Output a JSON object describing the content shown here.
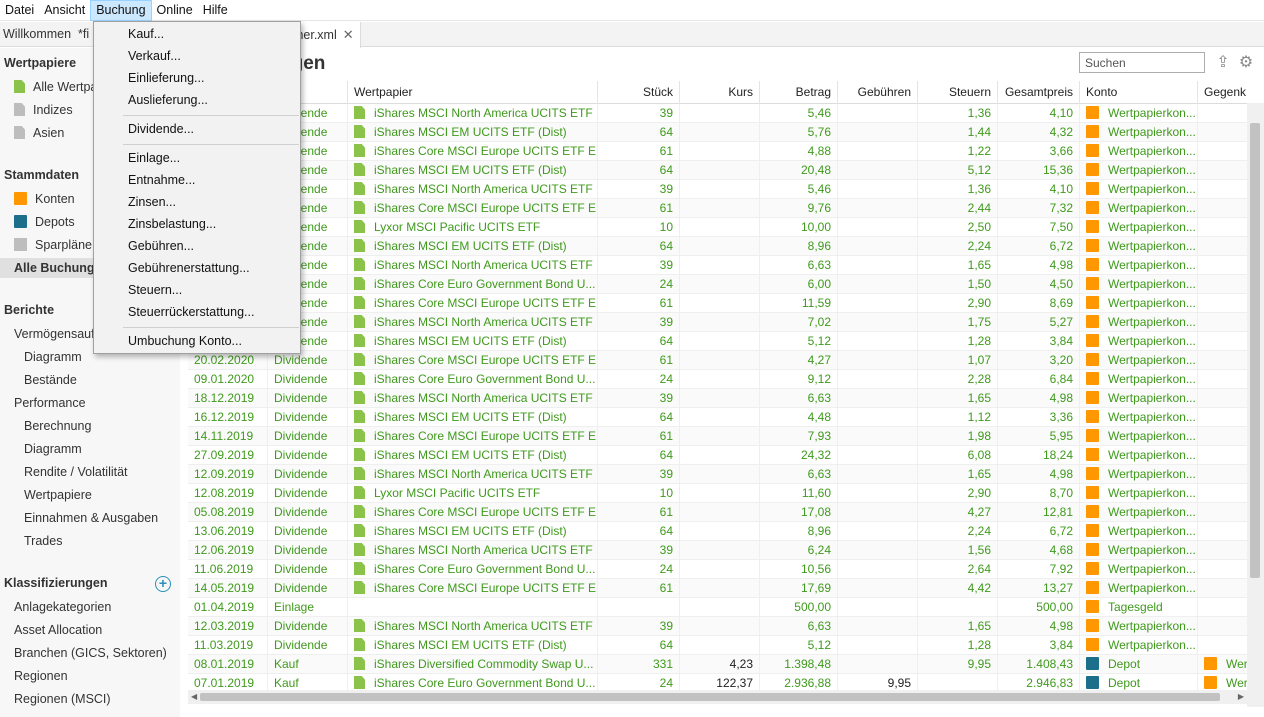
{
  "menubar": [
    "Datei",
    "Ansicht",
    "Buchung",
    "Online",
    "Hilfe"
  ],
  "tabs": {
    "welcome": "Willkommen",
    "modified_prefix": "*fi",
    "file_suffix": "mer.xml"
  },
  "sidebar": {
    "wertpapiere_head": "Wertpapiere",
    "wertpapiere": [
      "Alle Wertpa",
      "Indizes",
      "Asien"
    ],
    "stammdaten_head": "Stammdaten",
    "stammdaten": [
      "Konten",
      "Depots",
      "Sparpläne",
      "Alle Buchunge"
    ],
    "berichte_head": "Berichte",
    "berichte": [
      "Vermögensaufs",
      "Diagramm",
      "Bestände",
      "Performance",
      "Berechnung",
      "Diagramm",
      "Rendite / Volatilität",
      "Wertpapiere",
      "Einnahmen & Ausgaben",
      "Trades"
    ],
    "klass_head": "Klassifizierungen",
    "klass": [
      "Anlagekategorien",
      "Asset Allocation",
      "Branchen (GICS, Sektoren)",
      "Regionen",
      "Regionen (MSCI)"
    ]
  },
  "main": {
    "title": "ngen",
    "search_placeholder": "Suchen",
    "columns": [
      "Wertpapier",
      "Stück",
      "Kurs",
      "Betrag",
      "Gebühren",
      "Steuern",
      "Gesamtpreis",
      "Konto",
      "Gegenk"
    ]
  },
  "rows": [
    {
      "date": "",
      "type": "Dividende",
      "sec": "iShares MSCI North America UCITS ETF",
      "qty": "39",
      "price": "",
      "amount": "5,46",
      "fees": "",
      "taxes": "1,36",
      "total": "4,10",
      "acct": "Wertpapierkon...",
      "acct_icon": "orange",
      "counter": ""
    },
    {
      "date": "",
      "type": "Dividende",
      "sec": "iShares MSCI EM UCITS ETF (Dist)",
      "qty": "64",
      "price": "",
      "amount": "5,76",
      "fees": "",
      "taxes": "1,44",
      "total": "4,32",
      "acct": "Wertpapierkon...",
      "acct_icon": "orange",
      "counter": ""
    },
    {
      "date": "",
      "type": "Dividende",
      "sec": "iShares Core MSCI Europe UCITS ETF EU...",
      "qty": "61",
      "price": "",
      "amount": "4,88",
      "fees": "",
      "taxes": "1,22",
      "total": "3,66",
      "acct": "Wertpapierkon...",
      "acct_icon": "orange",
      "counter": ""
    },
    {
      "date": "",
      "type": "Dividende",
      "sec": "iShares MSCI EM UCITS ETF (Dist)",
      "qty": "64",
      "price": "",
      "amount": "20,48",
      "fees": "",
      "taxes": "5,12",
      "total": "15,36",
      "acct": "Wertpapierkon...",
      "acct_icon": "orange",
      "counter": ""
    },
    {
      "date": "",
      "type": "Dividende",
      "sec": "iShares MSCI North America UCITS ETF",
      "qty": "39",
      "price": "",
      "amount": "5,46",
      "fees": "",
      "taxes": "1,36",
      "total": "4,10",
      "acct": "Wertpapierkon...",
      "acct_icon": "orange",
      "counter": ""
    },
    {
      "date": "",
      "type": "Dividende",
      "sec": "iShares Core MSCI Europe UCITS ETF EU...",
      "qty": "61",
      "price": "",
      "amount": "9,76",
      "fees": "",
      "taxes": "2,44",
      "total": "7,32",
      "acct": "Wertpapierkon...",
      "acct_icon": "orange",
      "counter": ""
    },
    {
      "date": "",
      "type": "Dividende",
      "sec": "Lyxor MSCI Pacific UCITS ETF",
      "qty": "10",
      "price": "",
      "amount": "10,00",
      "fees": "",
      "taxes": "2,50",
      "total": "7,50",
      "acct": "Wertpapierkon...",
      "acct_icon": "orange",
      "counter": ""
    },
    {
      "date": "",
      "type": "Dividende",
      "sec": "iShares MSCI EM UCITS ETF (Dist)",
      "qty": "64",
      "price": "",
      "amount": "8,96",
      "fees": "",
      "taxes": "2,24",
      "total": "6,72",
      "acct": "Wertpapierkon...",
      "acct_icon": "orange",
      "counter": ""
    },
    {
      "date": "",
      "type": "Dividende",
      "sec": "iShares MSCI North America UCITS ETF",
      "qty": "39",
      "price": "",
      "amount": "6,63",
      "fees": "",
      "taxes": "1,65",
      "total": "4,98",
      "acct": "Wertpapierkon...",
      "acct_icon": "orange",
      "counter": ""
    },
    {
      "date": "",
      "type": "Dividende",
      "sec": "iShares Core Euro Government Bond U...",
      "qty": "24",
      "price": "",
      "amount": "6,00",
      "fees": "",
      "taxes": "1,50",
      "total": "4,50",
      "acct": "Wertpapierkon...",
      "acct_icon": "orange",
      "counter": ""
    },
    {
      "date": "",
      "type": "Dividende",
      "sec": "iShares Core MSCI Europe UCITS ETF EU...",
      "qty": "61",
      "price": "",
      "amount": "11,59",
      "fees": "",
      "taxes": "2,90",
      "total": "8,69",
      "acct": "Wertpapierkon...",
      "acct_icon": "orange",
      "counter": ""
    },
    {
      "date": "",
      "type": "Dividende",
      "sec": "iShares MSCI North America UCITS ETF",
      "qty": "39",
      "price": "",
      "amount": "7,02",
      "fees": "",
      "taxes": "1,75",
      "total": "5,27",
      "acct": "Wertpapierkon...",
      "acct_icon": "orange",
      "counter": ""
    },
    {
      "date": "",
      "type": "Dividende",
      "sec": "iShares MSCI EM UCITS ETF (Dist)",
      "qty": "64",
      "price": "",
      "amount": "5,12",
      "fees": "",
      "taxes": "1,28",
      "total": "3,84",
      "acct": "Wertpapierkon...",
      "acct_icon": "orange",
      "counter": ""
    },
    {
      "date": "20.02.2020",
      "type": "Dividende",
      "sec": "iShares Core MSCI Europe UCITS ETF EU...",
      "qty": "61",
      "price": "",
      "amount": "4,27",
      "fees": "",
      "taxes": "1,07",
      "total": "3,20",
      "acct": "Wertpapierkon...",
      "acct_icon": "orange",
      "counter": ""
    },
    {
      "date": "09.01.2020",
      "type": "Dividende",
      "sec": "iShares Core Euro Government Bond U...",
      "qty": "24",
      "price": "",
      "amount": "9,12",
      "fees": "",
      "taxes": "2,28",
      "total": "6,84",
      "acct": "Wertpapierkon...",
      "acct_icon": "orange",
      "counter": ""
    },
    {
      "date": "18.12.2019",
      "type": "Dividende",
      "sec": "iShares MSCI North America UCITS ETF",
      "qty": "39",
      "price": "",
      "amount": "6,63",
      "fees": "",
      "taxes": "1,65",
      "total": "4,98",
      "acct": "Wertpapierkon...",
      "acct_icon": "orange",
      "counter": ""
    },
    {
      "date": "16.12.2019",
      "type": "Dividende",
      "sec": "iShares MSCI EM UCITS ETF (Dist)",
      "qty": "64",
      "price": "",
      "amount": "4,48",
      "fees": "",
      "taxes": "1,12",
      "total": "3,36",
      "acct": "Wertpapierkon...",
      "acct_icon": "orange",
      "counter": ""
    },
    {
      "date": "14.11.2019",
      "type": "Dividende",
      "sec": "iShares Core MSCI Europe UCITS ETF EU...",
      "qty": "61",
      "price": "",
      "amount": "7,93",
      "fees": "",
      "taxes": "1,98",
      "total": "5,95",
      "acct": "Wertpapierkon...",
      "acct_icon": "orange",
      "counter": ""
    },
    {
      "date": "27.09.2019",
      "type": "Dividende",
      "sec": "iShares MSCI EM UCITS ETF (Dist)",
      "qty": "64",
      "price": "",
      "amount": "24,32",
      "fees": "",
      "taxes": "6,08",
      "total": "18,24",
      "acct": "Wertpapierkon...",
      "acct_icon": "orange",
      "counter": ""
    },
    {
      "date": "12.09.2019",
      "type": "Dividende",
      "sec": "iShares MSCI North America UCITS ETF",
      "qty": "39",
      "price": "",
      "amount": "6,63",
      "fees": "",
      "taxes": "1,65",
      "total": "4,98",
      "acct": "Wertpapierkon...",
      "acct_icon": "orange",
      "counter": ""
    },
    {
      "date": "12.08.2019",
      "type": "Dividende",
      "sec": "Lyxor MSCI Pacific UCITS ETF",
      "qty": "10",
      "price": "",
      "amount": "11,60",
      "fees": "",
      "taxes": "2,90",
      "total": "8,70",
      "acct": "Wertpapierkon...",
      "acct_icon": "orange",
      "counter": ""
    },
    {
      "date": "05.08.2019",
      "type": "Dividende",
      "sec": "iShares Core MSCI Europe UCITS ETF EU...",
      "qty": "61",
      "price": "",
      "amount": "17,08",
      "fees": "",
      "taxes": "4,27",
      "total": "12,81",
      "acct": "Wertpapierkon...",
      "acct_icon": "orange",
      "counter": ""
    },
    {
      "date": "13.06.2019",
      "type": "Dividende",
      "sec": "iShares MSCI EM UCITS ETF (Dist)",
      "qty": "64",
      "price": "",
      "amount": "8,96",
      "fees": "",
      "taxes": "2,24",
      "total": "6,72",
      "acct": "Wertpapierkon...",
      "acct_icon": "orange",
      "counter": ""
    },
    {
      "date": "12.06.2019",
      "type": "Dividende",
      "sec": "iShares MSCI North America UCITS ETF",
      "qty": "39",
      "price": "",
      "amount": "6,24",
      "fees": "",
      "taxes": "1,56",
      "total": "4,68",
      "acct": "Wertpapierkon...",
      "acct_icon": "orange",
      "counter": ""
    },
    {
      "date": "11.06.2019",
      "type": "Dividende",
      "sec": "iShares Core Euro Government Bond U...",
      "qty": "24",
      "price": "",
      "amount": "10,56",
      "fees": "",
      "taxes": "2,64",
      "total": "7,92",
      "acct": "Wertpapierkon...",
      "acct_icon": "orange",
      "counter": ""
    },
    {
      "date": "14.05.2019",
      "type": "Dividende",
      "sec": "iShares Core MSCI Europe UCITS ETF EU...",
      "qty": "61",
      "price": "",
      "amount": "17,69",
      "fees": "",
      "taxes": "4,42",
      "total": "13,27",
      "acct": "Wertpapierkon...",
      "acct_icon": "orange",
      "counter": ""
    },
    {
      "date": "01.04.2019",
      "type": "Einlage",
      "sec": "",
      "qty": "",
      "price": "",
      "amount": "500,00",
      "fees": "",
      "taxes": "",
      "total": "500,00",
      "acct": "Tagesgeld",
      "acct_icon": "orange",
      "counter": ""
    },
    {
      "date": "12.03.2019",
      "type": "Dividende",
      "sec": "iShares MSCI North America UCITS ETF",
      "qty": "39",
      "price": "",
      "amount": "6,63",
      "fees": "",
      "taxes": "1,65",
      "total": "4,98",
      "acct": "Wertpapierkon...",
      "acct_icon": "orange",
      "counter": ""
    },
    {
      "date": "11.03.2019",
      "type": "Dividende",
      "sec": "iShares MSCI EM UCITS ETF (Dist)",
      "qty": "64",
      "price": "",
      "amount": "5,12",
      "fees": "",
      "taxes": "1,28",
      "total": "3,84",
      "acct": "Wertpapierkon...",
      "acct_icon": "orange",
      "counter": ""
    },
    {
      "date": "08.01.2019",
      "type": "Kauf",
      "sec": "iShares Diversified Commodity Swap U...",
      "qty": "331",
      "price": "4,23",
      "amount": "1.398,48",
      "fees": "",
      "taxes": "9,95",
      "total": "1.408,43",
      "acct": "Depot",
      "acct_icon": "teal",
      "counter": "Wert"
    },
    {
      "date": "07.01.2019",
      "type": "Kauf",
      "sec": "iShares Core Euro Government Bond U...",
      "qty": "24",
      "price": "122,37",
      "amount": "2.936,88",
      "fees": "9,95",
      "taxes": "",
      "total": "2.946,83",
      "acct": "Depot",
      "acct_icon": "teal",
      "counter": "Wert"
    }
  ],
  "dropdown": {
    "group1": [
      "Kauf...",
      "Verkauf...",
      "Einlieferung...",
      "Auslieferung..."
    ],
    "group2": [
      "Dividende..."
    ],
    "group3": [
      "Einlage...",
      "Entnahme...",
      "Zinsen...",
      "Zinsbelastung...",
      "Gebühren...",
      "Gebührenerstattung...",
      "Steuern...",
      "Steuerrückerstattung..."
    ],
    "group4": [
      "Umbuchung Konto..."
    ]
  },
  "colors": {
    "accent_green": "#3f9a1c",
    "account_orange": "#ff9800",
    "depot_teal": "#1b6f8a",
    "menu_highlight": "#cce8ff"
  }
}
